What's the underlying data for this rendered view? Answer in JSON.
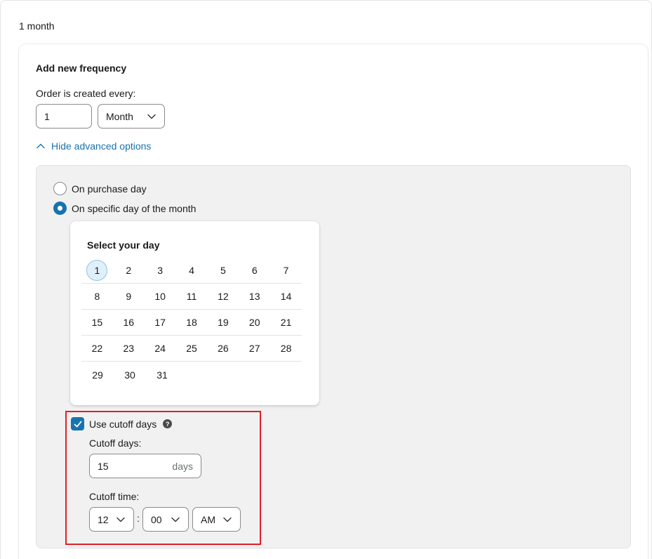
{
  "summary": {
    "label": "1 month"
  },
  "frequency": {
    "title": "Add new frequency",
    "order_label": "Order is created every:",
    "interval_value": "1",
    "unit_selected": "Month",
    "toggle_label": "Hide advanced options"
  },
  "advanced": {
    "radio_purchase_day": "On purchase day",
    "radio_specific_day": "On specific day of the month",
    "selected_option": "On specific day of the month",
    "day_picker": {
      "title": "Select your day",
      "selected_day": "1",
      "rows": [
        [
          "1",
          "2",
          "3",
          "4",
          "5",
          "6",
          "7"
        ],
        [
          "8",
          "9",
          "10",
          "11",
          "12",
          "13",
          "14"
        ],
        [
          "15",
          "16",
          "17",
          "18",
          "19",
          "20",
          "21"
        ],
        [
          "22",
          "23",
          "24",
          "25",
          "26",
          "27",
          "28"
        ],
        [
          "29",
          "30",
          "31"
        ]
      ]
    },
    "cutoff": {
      "checkbox_label": "Use cutoff days",
      "checked": true,
      "help_icon": "question-circle-icon",
      "days_label": "Cutoff days:",
      "days_value": "15",
      "days_suffix": "days",
      "time_label": "Cutoff time:",
      "hour": "12",
      "separator": ":",
      "minute": "00",
      "period": "AM"
    }
  },
  "colors": {
    "accent": "#1773b0",
    "highlight": "#e0202a",
    "panel_bg": "#f1f1f1",
    "selected_day_bg": "#e0f0fb"
  }
}
